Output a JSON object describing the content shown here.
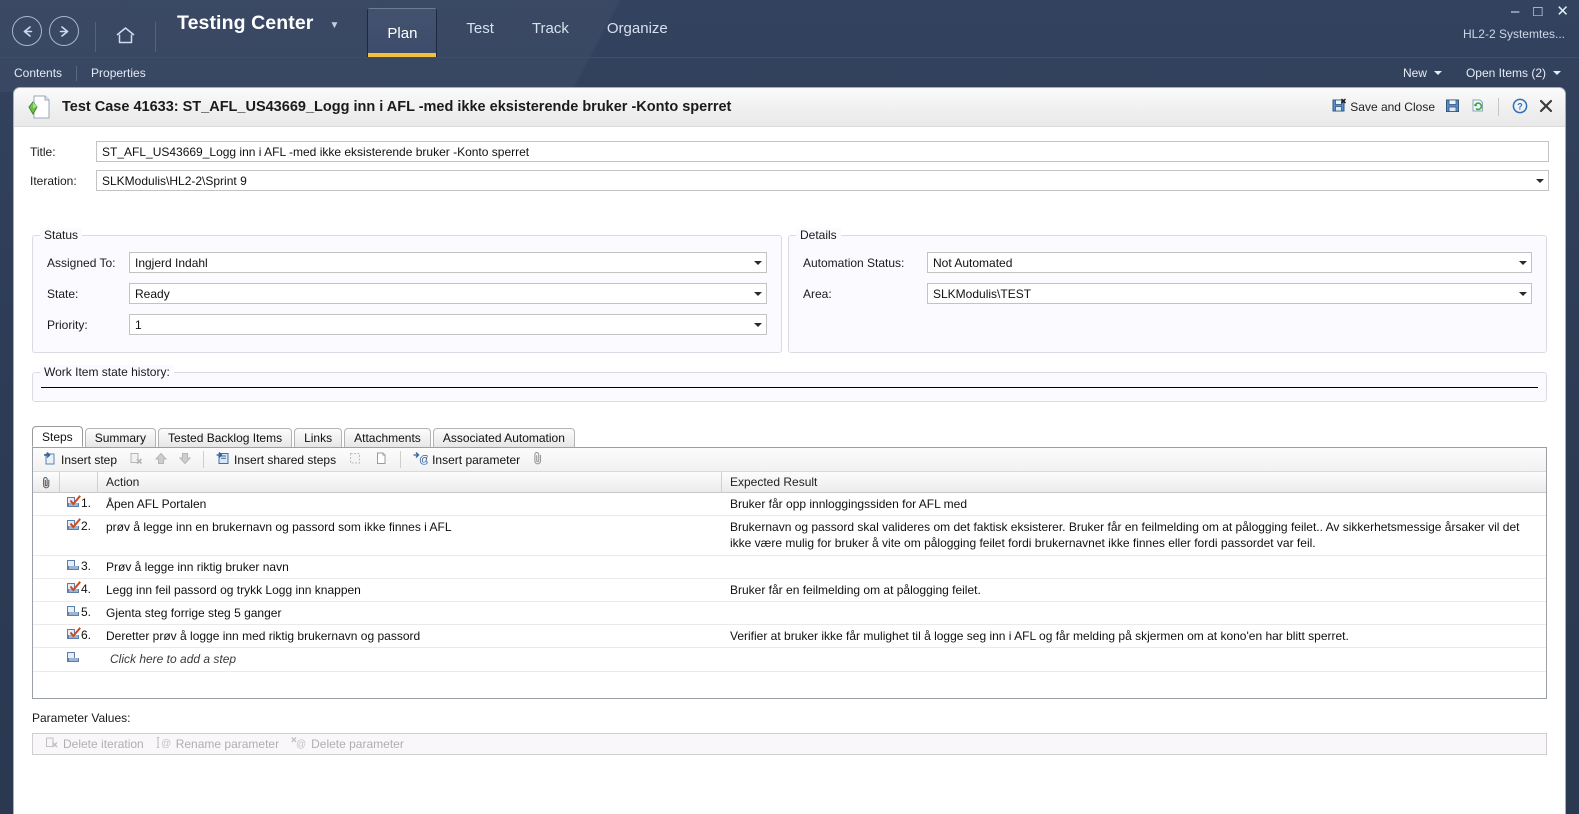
{
  "window": {
    "minimize": "–",
    "maximize": "□",
    "close": "✕",
    "user": "HL2-2 Systemtes..."
  },
  "titlebar": {
    "back_icon": "back-arrow-icon",
    "forward_icon": "forward-arrow-icon",
    "home_icon": "home-icon",
    "app_title": "Testing Center",
    "dropdown_icon": "chevron-down-icon",
    "tabs": [
      {
        "label": "Plan",
        "active": true
      },
      {
        "label": "Test",
        "active": false
      },
      {
        "label": "Track",
        "active": false
      },
      {
        "label": "Organize",
        "active": false
      }
    ]
  },
  "subbar": {
    "links": [
      "Contents",
      "Properties"
    ],
    "new_label": "New",
    "open_items_label": "Open Items (2)"
  },
  "doc": {
    "icon": "test-case-document-icon",
    "title": "Test Case 41633: ST_AFL_US43669_Logg inn i AFL -med  ikke eksisterende  bruker -Konto sperret",
    "actions": {
      "save_and_close": "Save and Close",
      "save_icon": "save-disk-icon",
      "refresh_icon": "refresh-icon",
      "help_icon": "help-question-icon",
      "close_icon": "close-x-icon"
    }
  },
  "fields": {
    "title_label": "Title:",
    "title_value": "ST_AFL_US43669_Logg inn i AFL -med  ikke eksisterende  bruker -Konto sperret",
    "iteration_label": "Iteration:",
    "iteration_value": "SLKModulis\\HL2-2\\Sprint 9"
  },
  "status_group": {
    "title": "Status",
    "rows": [
      {
        "label": "Assigned To:",
        "value": "Ingjerd Indahl"
      },
      {
        "label": "State:",
        "value": "Ready"
      },
      {
        "label": "Priority:",
        "value": "1"
      }
    ]
  },
  "details_group": {
    "title": "Details",
    "rows": [
      {
        "label": "Automation Status:",
        "value": "Not Automated"
      },
      {
        "label": "Area:",
        "value": "SLKModulis\\TEST"
      }
    ]
  },
  "history_group": {
    "title": "Work Item state history:"
  },
  "tabs": [
    {
      "label": "Steps",
      "active": true
    },
    {
      "label": "Summary",
      "active": false
    },
    {
      "label": "Tested Backlog Items",
      "active": false
    },
    {
      "label": "Links",
      "active": false
    },
    {
      "label": "Attachments",
      "active": false
    },
    {
      "label": "Associated Automation",
      "active": false
    }
  ],
  "steps_toolbar": {
    "insert_step": "Insert step",
    "insert_step_icon": "insert-step-icon",
    "delete_step_icon": "delete-step-icon",
    "move_up_icon": "arrow-up-icon",
    "move_down_icon": "arrow-down-icon",
    "insert_shared_steps": "Insert shared steps",
    "insert_shared_steps_icon": "insert-shared-steps-icon",
    "create_shared_step_icon": "create-shared-step-icon",
    "open_shared_step_icon": "open-shared-step-icon",
    "insert_parameter": "Insert parameter",
    "insert_parameter_icon": "insert-parameter-icon",
    "attachment_icon": "paperclip-icon"
  },
  "steps_grid": {
    "columns": {
      "attachment_icon": "paperclip-icon",
      "action": "Action",
      "expected_result": "Expected Result"
    },
    "rows": [
      {
        "num": "1.",
        "validation": true,
        "action": "Åpen AFL  Portalen",
        "expected": "Bruker får opp  innloggingssiden for AFL med"
      },
      {
        "num": "2.",
        "validation": true,
        "action": "prøv å  legge inn en brukernavn og passord som ikke finnes i AFL",
        "expected": "Brukernavn og passord skal valideres om  det  faktisk eksisterer. Bruker får en feilmelding om at pålogging feilet.. Av sikkerhetsmessige årsaker vil det ikke være mulig for bruker å vite om pålogging feilet fordi brukernavnet ikke finnes eller fordi passordet var feil."
      },
      {
        "num": "3.",
        "validation": false,
        "action": "Prøv å legge inn riktig  bruker navn",
        "expected": ""
      },
      {
        "num": "4.",
        "validation": true,
        "action": "Legg inn feil passord og trykk  Logg inn knappen",
        "expected": "Bruker får en feilmelding om at pålogging feilet."
      },
      {
        "num": "5.",
        "validation": false,
        "action": "Gjenta steg forrige steg 5 ganger",
        "expected": ""
      },
      {
        "num": "6.",
        "validation": true,
        "action": "Deretter  prøv å logge  inn med riktig brukernavn og passord",
        "expected": "Verifier at bruker ikke får mulighet til å logge seg inn i AFL og får melding på skjermen om at kono'en har blitt sperret."
      }
    ],
    "add_row_placeholder": "Click here to add a step"
  },
  "parameter_values": {
    "label": "Parameter Values:",
    "buttons": [
      {
        "label": "Delete iteration",
        "icon": "delete-iteration-icon"
      },
      {
        "label": "Rename parameter",
        "icon": "rename-parameter-icon"
      },
      {
        "label": "Delete parameter",
        "icon": "delete-parameter-icon"
      }
    ]
  },
  "colors": {
    "chrome": "#2d3b55",
    "active_tab_underline": "#f2c13c",
    "panel": "#ffffff",
    "group_bg": "#fbfaff",
    "validation_check": "#d04a20"
  }
}
